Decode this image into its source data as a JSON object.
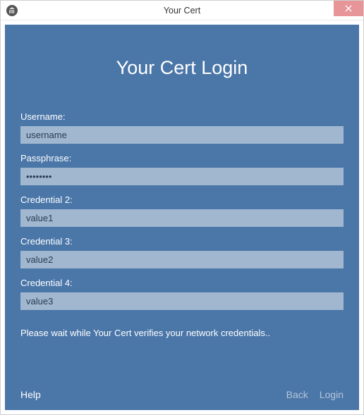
{
  "window": {
    "title": "Your Cert"
  },
  "heading": "Your Cert Login",
  "fields": [
    {
      "label": "Username:",
      "value": "username",
      "type": "text"
    },
    {
      "label": "Passphrase:",
      "value": "••••••••",
      "type": "password"
    },
    {
      "label": "Credential 2:",
      "value": "value1",
      "type": "text"
    },
    {
      "label": "Credential 3:",
      "value": "value2",
      "type": "text"
    },
    {
      "label": "Credential 4:",
      "value": "value3",
      "type": "text"
    }
  ],
  "status": "Please wait while Your Cert verifies your network credentials..",
  "footer": {
    "help": "Help",
    "back": "Back",
    "login": "Login"
  },
  "colors": {
    "panel": "#4a76a8",
    "input_bg": "#a0b7cf",
    "close_bg": "#e8959a"
  }
}
